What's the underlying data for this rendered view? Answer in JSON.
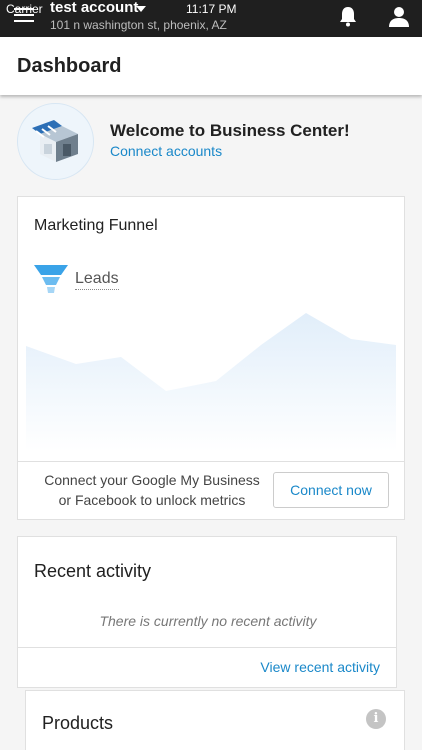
{
  "status_bar": {
    "carrier": "Carrier",
    "time": "11:17 PM"
  },
  "top_bar": {
    "account_name": "test account",
    "account_address": "101 n washington st, phoenix, AZ",
    "icons": [
      "menu-icon",
      "chevron-down-icon",
      "bell-icon",
      "user-icon"
    ]
  },
  "header": {
    "title": "Dashboard"
  },
  "welcome": {
    "title": "Welcome to Business Center!",
    "link": "Connect accounts"
  },
  "funnel": {
    "title": "Marketing Funnel",
    "metric_label": "Leads",
    "connect_text_line1": "Connect your Google My Business",
    "connect_text_line2": "or Facebook to unlock metrics",
    "connect_button": "Connect now"
  },
  "activity": {
    "title": "Recent activity",
    "empty_text": "There is currently no recent activity",
    "link": "View recent activity"
  },
  "products": {
    "title": "Products"
  },
  "colors": {
    "topbar": "#1f1f1f",
    "accent": "#1a88c9",
    "chart_fill": "#e3f1fc"
  }
}
